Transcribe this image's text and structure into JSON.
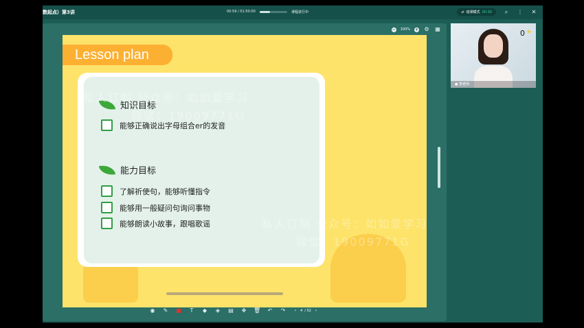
{
  "header": {
    "course_title": "数起点）第3讲",
    "time_current": "00:59",
    "time_separator": "/",
    "time_total": "01:50:00",
    "progress": 0.38,
    "status": "课程进行中",
    "switch_label": "班课模式",
    "switch_time": "00:30"
  },
  "stage": {
    "zoom": "100%"
  },
  "slide": {
    "title": "Lesson plan",
    "section1": {
      "heading": "知识目标",
      "items": [
        "能够正确说出字母组合er的发音"
      ]
    },
    "section2": {
      "heading": "能力目标",
      "items": [
        "了解祈使句，能够听懂指令",
        "能够用一般疑问句询问事物",
        "能够朗读小故事，跟唱歌谣"
      ]
    },
    "watermark_line1": "私人订制 公众号：如如爱学习",
    "watermark_line2": "微信：19009771G"
  },
  "pager": {
    "current": "4",
    "total": "/ 52"
  },
  "video": {
    "score": "0",
    "name": "李老师"
  },
  "colors": {
    "app_bg": "#1c5d55",
    "slide_bg": "#fde36a",
    "accent_green": "#2f9e44",
    "tab_orange": "#fcb032"
  }
}
